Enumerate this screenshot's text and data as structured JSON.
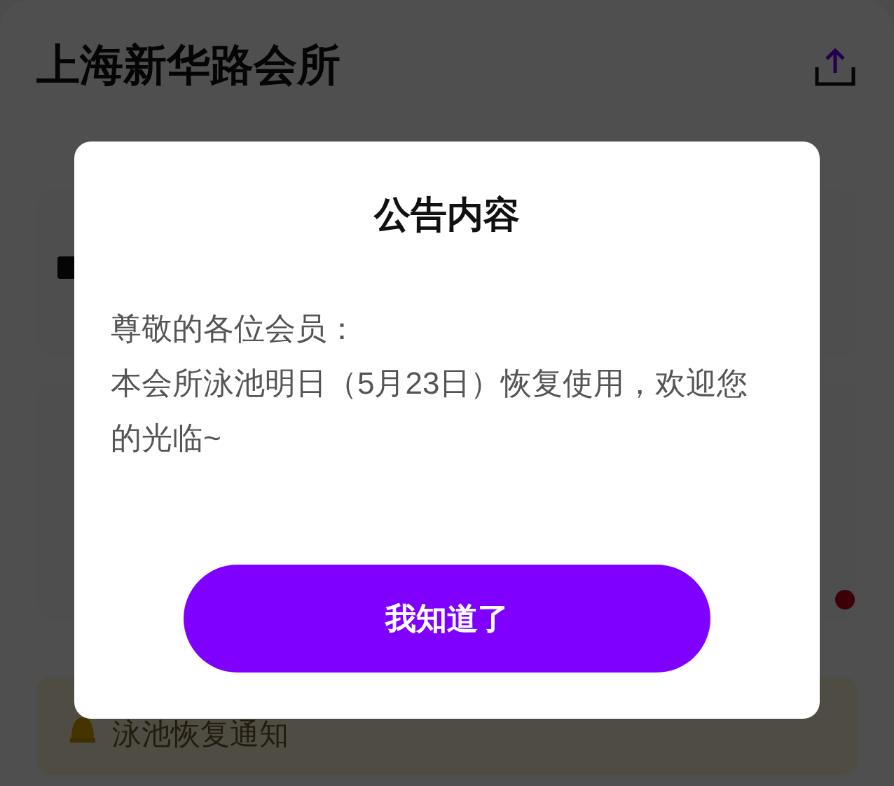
{
  "page": {
    "title": "上海新华路会所",
    "notice": "泳池恢复通知"
  },
  "dialog": {
    "title": "公告内容",
    "lines": [
      "尊敬的各位会员：",
      "本会所泳池明日（5月23日）恢复使用，欢迎您的光临~"
    ],
    "button": "我知道了"
  }
}
